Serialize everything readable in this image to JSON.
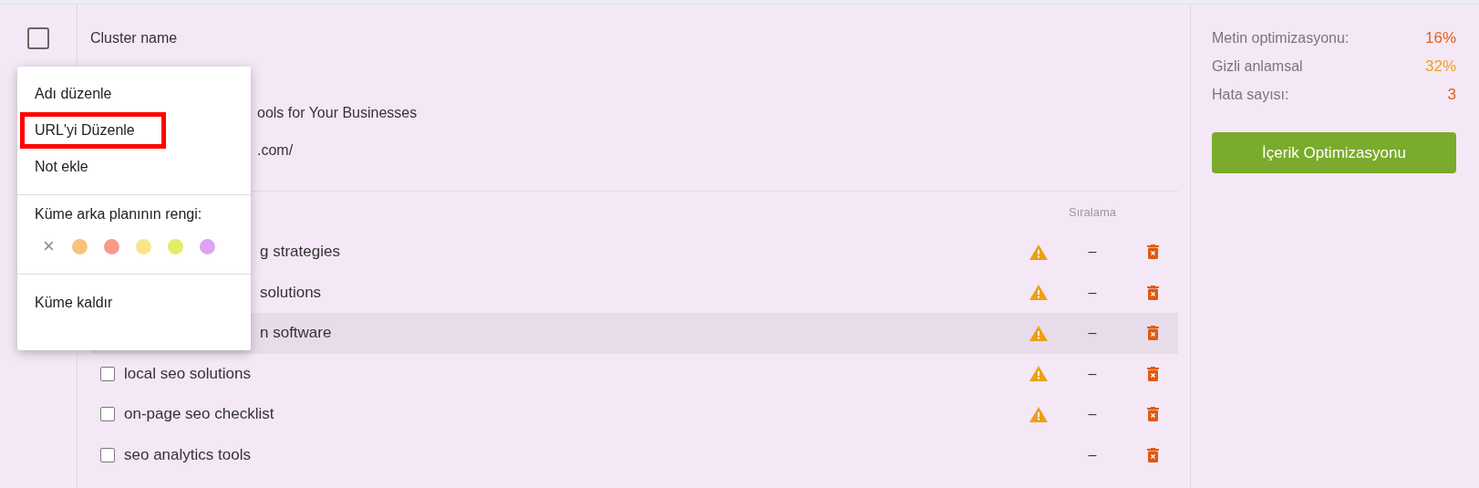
{
  "cluster": {
    "checked": false,
    "header_lines": [
      {
        "kind": "full",
        "text": "Cluster name"
      },
      {
        "kind": "covered",
        "text": "ools for Your Businesses"
      },
      {
        "kind": "covered",
        "text": ".com/"
      }
    ],
    "rank_header": "Sıralama",
    "rows": [
      {
        "kind": "covered",
        "text": "g strategies",
        "warning": true,
        "rank": "–",
        "highlighted": false
      },
      {
        "kind": "covered",
        "text": "solutions",
        "warning": true,
        "rank": "–",
        "highlighted": false
      },
      {
        "kind": "covered",
        "text": "n software",
        "warning": true,
        "rank": "–",
        "highlighted": true
      },
      {
        "kind": "full",
        "text": "local seo solutions",
        "checked": false,
        "warning": true,
        "rank": "–",
        "highlighted": false
      },
      {
        "kind": "full",
        "text": "on-page seo checklist",
        "checked": false,
        "warning": true,
        "rank": "–",
        "highlighted": false
      },
      {
        "kind": "full",
        "text": "seo analytics tools",
        "checked": false,
        "warning": false,
        "rank": "–",
        "highlighted": false
      }
    ]
  },
  "stats": [
    {
      "label": "Metin optimizasyonu:",
      "value": "16%",
      "color": "#e0601a"
    },
    {
      "label": "Gizli anlamsal",
      "value": "32%",
      "color": "#f0a020"
    },
    {
      "label": "Hata sayısı:",
      "value": "3",
      "color": "#e0601a"
    }
  ],
  "optimize_button": "İçerik Optimizasyonu",
  "context_menu": {
    "items": [
      {
        "label": "Adı düzenle",
        "highlighted": false
      },
      {
        "label": "URL'yi Düzenle",
        "highlighted": true
      },
      {
        "label": "Not ekle",
        "highlighted": false
      }
    ],
    "color_label": "Küme arka planının rengi:",
    "clear_symbol": "×",
    "colors": [
      {
        "color": "#f9c27a"
      },
      {
        "color": "#f99a88"
      },
      {
        "color": "#fde48a"
      },
      {
        "color": "#e0ee6a"
      },
      {
        "color": "#dba5f0"
      }
    ],
    "remove_item": "Küme kaldır"
  }
}
